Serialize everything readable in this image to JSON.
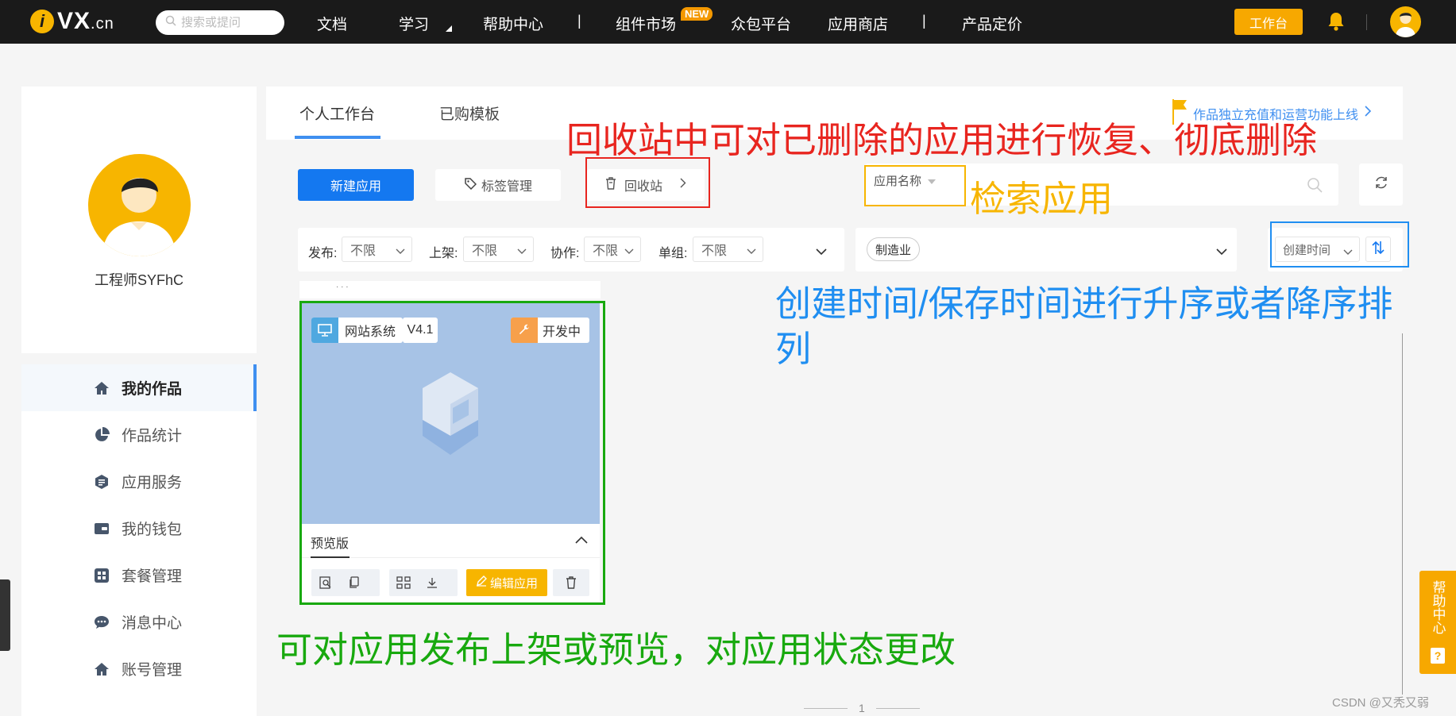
{
  "nav": {
    "logo_text": "VX",
    "logo_suffix": ".cn",
    "search_placeholder": "搜索或提问",
    "links": [
      "文档",
      "学习",
      "帮助中心",
      "组件市场",
      "众包平台",
      "应用商店",
      "产品定价"
    ],
    "separator": "|",
    "new_badge": "NEW",
    "workbench": "工作台"
  },
  "sidebar": {
    "username": "工程师SYFhC",
    "items": [
      {
        "label": "我的作品",
        "icon": "home-icon"
      },
      {
        "label": "作品统计",
        "icon": "pie-chart-icon"
      },
      {
        "label": "应用服务",
        "icon": "service-icon"
      },
      {
        "label": "我的钱包",
        "icon": "wallet-icon"
      },
      {
        "label": "套餐管理",
        "icon": "grid-icon"
      },
      {
        "label": "消息中心",
        "icon": "chat-icon"
      },
      {
        "label": "账号管理",
        "icon": "home-icon"
      }
    ]
  },
  "tabs": [
    "个人工作台",
    "已购模板"
  ],
  "notice": "作品独立充值和运营功能上线",
  "toolbar": {
    "new_app": "新建应用",
    "tag_manage": "标签管理",
    "recycle_bin": "回收站",
    "search_field": "应用名称"
  },
  "filters": [
    {
      "label": "发布:",
      "value": "不限"
    },
    {
      "label": "上架:",
      "value": "不限"
    },
    {
      "label": "协作:",
      "value": "不限"
    },
    {
      "label": "单组:",
      "value": "不限"
    }
  ],
  "tag_filter": "制造业",
  "sort": {
    "field": "创建时间"
  },
  "card": {
    "type": "网站系统",
    "version": "V4.1",
    "status": "开发中",
    "preview_tab": "预览版",
    "edit": "编辑应用",
    "top_dots": "· · ·"
  },
  "annotations": {
    "recycle": "回收站中可对已删除的应用进行恢复、彻底删除",
    "search": "检索应用",
    "sort_line1": "创建时间/保存时间进行升序或者降序排",
    "sort_line2": "列",
    "card": "可对应用发布上架或预览，对应用状态更改"
  },
  "annotation_colors": {
    "red": "#e8251f",
    "yellow": "#f7b500",
    "blue": "#1f8ef1",
    "green": "#18a90e"
  },
  "help_float": "帮助中心",
  "pager": "1",
  "watermark": "CSDN @又秃又弱"
}
